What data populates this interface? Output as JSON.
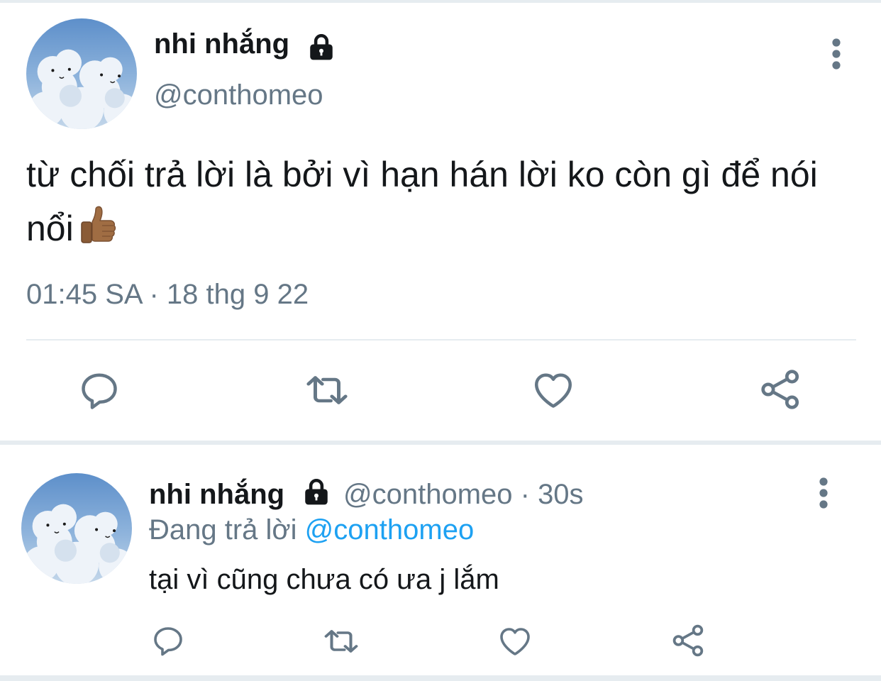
{
  "main_tweet": {
    "display_name": "nhi nhắng",
    "handle": "@conthomeo",
    "text": "từ chối trả lời là bởi vì hạn hán lời ko còn gì để nói nổi",
    "emoji": "thumbs-up-icon",
    "timestamp": "01:45 SA · 18 thg 9 22"
  },
  "reply_tweet": {
    "display_name": "nhi nhắng",
    "meta": "@conthomeo · 30s",
    "replying_label": "Đang trả lời",
    "replying_mention": "@conthomeo",
    "text": "tại vì cũng chưa có ưa j lắm"
  },
  "actions": [
    "reply-icon",
    "retweet-icon",
    "like-icon",
    "share-icon"
  ],
  "colors": {
    "text": "#14171a",
    "secondary": "#657786",
    "link": "#1da1f2",
    "divider": "#e6ecf0",
    "icon": "#657786"
  }
}
